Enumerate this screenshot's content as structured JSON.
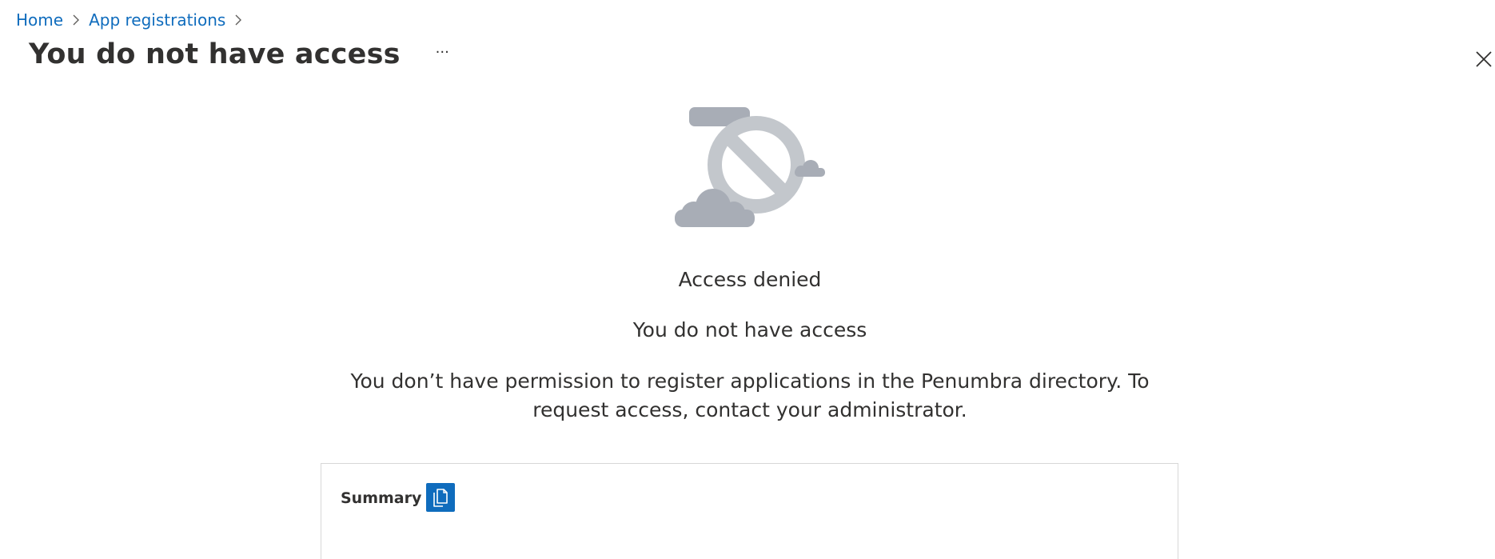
{
  "breadcrumb": {
    "items": [
      {
        "label": "Home"
      },
      {
        "label": "App registrations"
      }
    ]
  },
  "header": {
    "title": "You do not have access",
    "more_label": "···"
  },
  "illustration": {
    "icon": "access-denied-cloud-icon",
    "colors": {
      "circle": "#c3c7cc",
      "cloud": "#a8adb6"
    }
  },
  "message": {
    "status": "Access denied",
    "title": "You do not have access",
    "description": "You don’t have permission to register applications in the Penumbra directory. To request access, contact your administrator."
  },
  "summary": {
    "label": "Summary",
    "copy_icon": "copy-icon"
  },
  "colors": {
    "accent": "#0f6cbd",
    "text": "#323130",
    "border": "#d7d7d7"
  }
}
